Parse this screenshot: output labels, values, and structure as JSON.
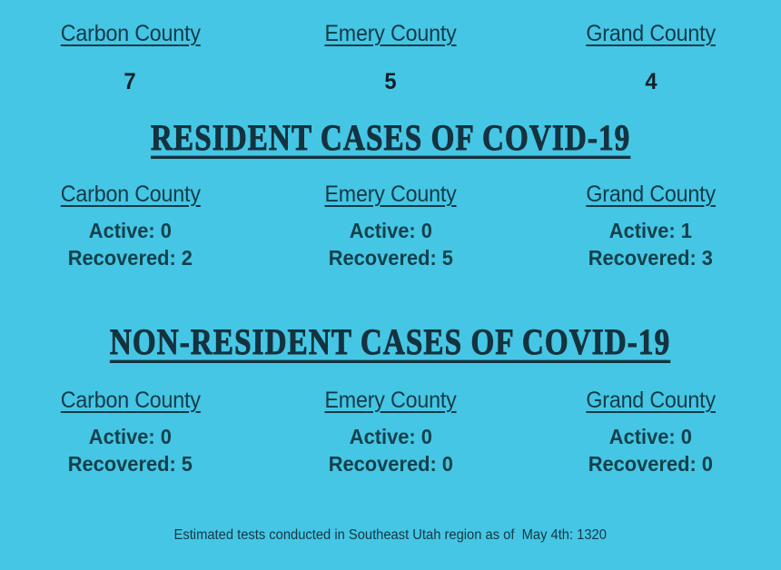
{
  "background_color": "#45c6e4",
  "text_color": "#14414c",
  "heading_color": "#14323f",
  "totals": {
    "columns": [
      {
        "county": "Carbon County",
        "count": "7"
      },
      {
        "county": "Emery County",
        "count": "5"
      },
      {
        "county": "Grand County",
        "count": "4"
      }
    ]
  },
  "resident": {
    "heading": "RESIDENT CASES OF COVID-19",
    "columns": [
      {
        "county": "Carbon County",
        "active": "Active: 0",
        "recovered": "Recovered: 2"
      },
      {
        "county": "Emery County",
        "active": "Active: 0",
        "recovered": "Recovered: 5"
      },
      {
        "county": "Grand County",
        "active": "Active: 1",
        "recovered": "Recovered: 3"
      }
    ]
  },
  "non_resident": {
    "heading": "NON-RESIDENT CASES OF COVID-19",
    "columns": [
      {
        "county": "Carbon County",
        "active": "Active: 0",
        "recovered": "Recovered: 5"
      },
      {
        "county": "Emery County",
        "active": "Active: 0",
        "recovered": "Recovered: 0"
      },
      {
        "county": "Grand County",
        "active": "Active: 0",
        "recovered": "Recovered: 0"
      }
    ]
  },
  "footer": {
    "text": "Estimated tests conducted in Southeast Utah region as of  May 4th: 1320"
  }
}
